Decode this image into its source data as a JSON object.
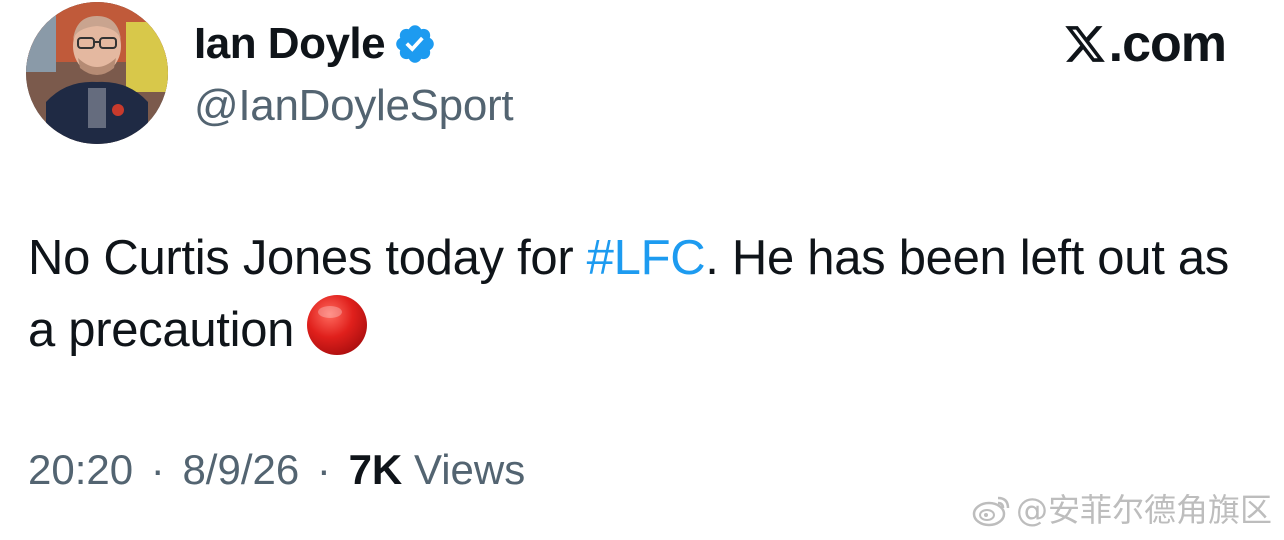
{
  "author": {
    "display_name": "Ian Doyle",
    "handle": "@IanDoyleSport",
    "verified": true
  },
  "brand": {
    "text": ".com",
    "logo_icon": "x-logo-icon"
  },
  "tweet": {
    "text_before_hashtag": "No Curtis Jones today for ",
    "hashtag": "#LFC",
    "text_after_hashtag": ". He has been left out as a precaution",
    "emoji_icon": "red-circle-icon"
  },
  "meta": {
    "time": "20:20",
    "date": "8/9/26",
    "view_count": "7K",
    "views_label": "Views",
    "separator": "·"
  },
  "watermark": {
    "text": "@安菲尔德角旗区",
    "icon": "weibo-icon"
  },
  "colors": {
    "text_primary": "#0f1419",
    "text_secondary": "#536471",
    "hashtag": "#1d9bf0",
    "verified": "#1d9bf0",
    "emoji_red": "#d81e1e"
  }
}
